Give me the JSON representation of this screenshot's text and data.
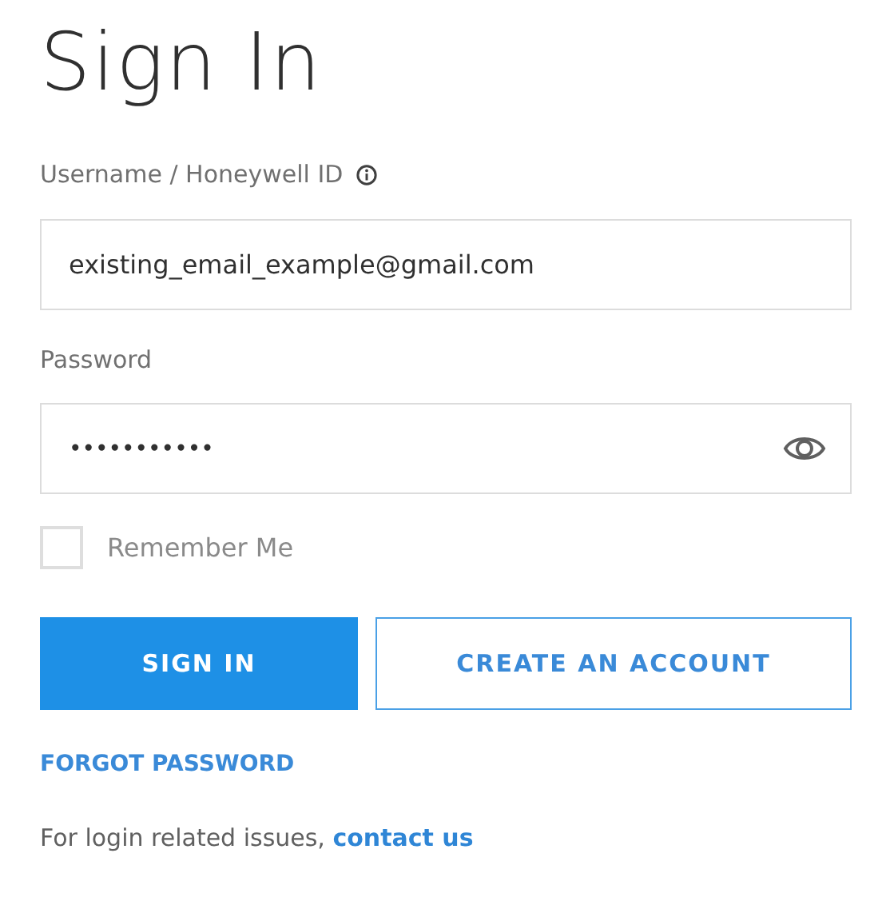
{
  "title": "Sign In",
  "username": {
    "label": "Username / Honeywell ID",
    "value": "existing_email_example@gmail.com"
  },
  "password": {
    "label": "Password",
    "value": "•••••••••••"
  },
  "remember_me": {
    "label": "Remember Me",
    "checked": false
  },
  "buttons": [
    {
      "label": "SIGN IN",
      "kind": "primary"
    },
    {
      "label": "CREATE AN ACCOUNT",
      "kind": "outline"
    }
  ],
  "forgot_link": "FORGOT PASSWORD",
  "help": {
    "text": "For login related issues, ",
    "link": "contact us"
  }
}
